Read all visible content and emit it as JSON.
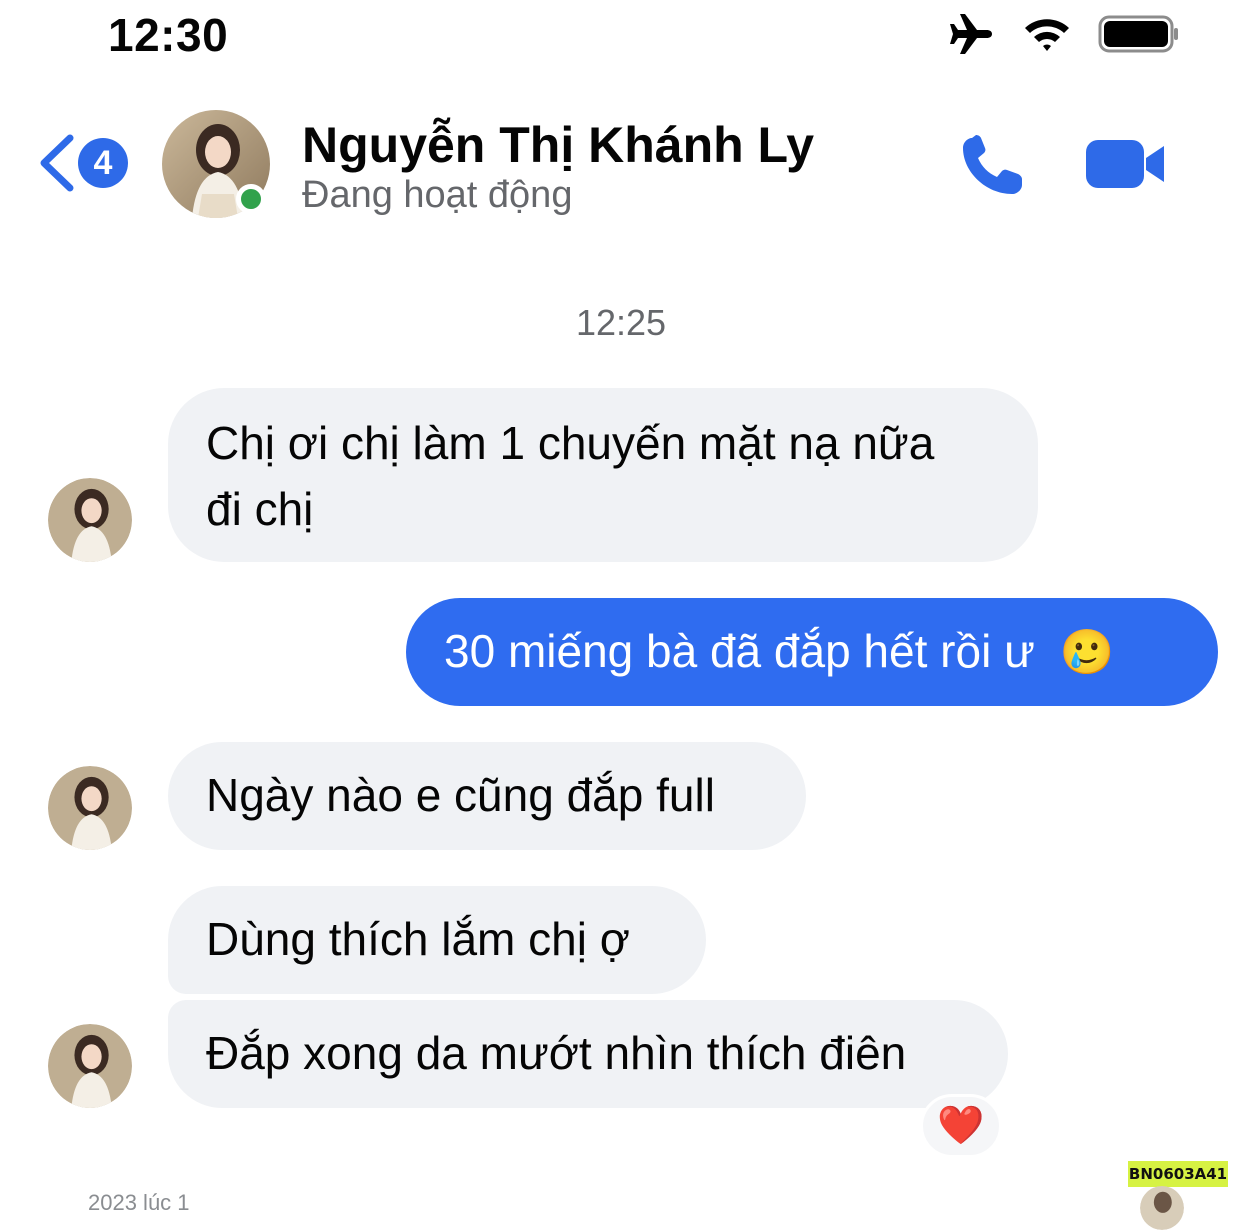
{
  "status_bar": {
    "time": "12:30",
    "icons": [
      "airplane-icon",
      "wifi-icon",
      "battery-icon"
    ]
  },
  "header": {
    "back_count": "4",
    "contact_name": "Nguyễn Thị Khánh Ly",
    "contact_status": "Đang hoạt động",
    "icons": [
      "back-chevron-icon",
      "phone-icon",
      "video-camera-icon"
    ],
    "accent_color": "#2e6ae8",
    "online_color": "#31a24c"
  },
  "conversation": {
    "timestamp": "12:25",
    "messages": [
      {
        "direction": "in",
        "text_line1": "Chị ơi chị làm 1 chuyến mặt nạ nữa",
        "text_line2": "đi chị"
      },
      {
        "direction": "out",
        "text": "30 miếng bà đã đắp hết rồi ư",
        "emoji": "🥲"
      },
      {
        "direction": "in",
        "text": "Ngày nào e cũng đắp full"
      },
      {
        "direction": "in",
        "text": "Dùng thích lắm chị ợ"
      },
      {
        "direction": "in",
        "text": "Đắp xong da mướt nhìn thích điên",
        "reaction": "❤️"
      }
    ],
    "incoming_bubble_color": "#f0f2f5",
    "outgoing_bubble_color": "#2f6cf0"
  },
  "watermark": "BN0603A41",
  "footer_partial_text": "2023 lúc 1"
}
